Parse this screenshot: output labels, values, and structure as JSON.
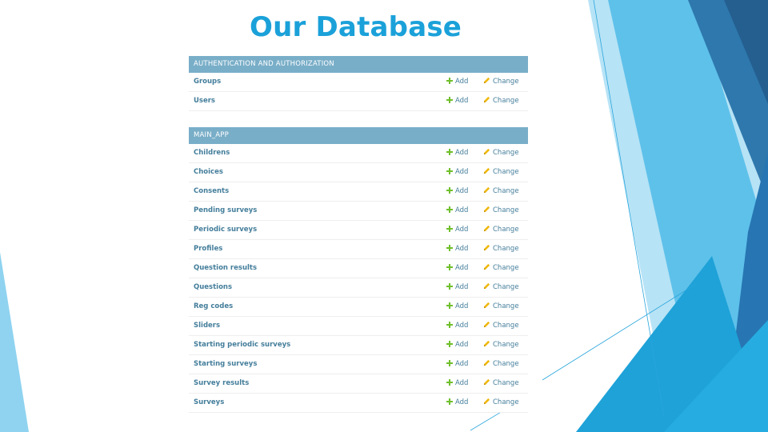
{
  "slide": {
    "title": "Our Database"
  },
  "colors": {
    "title": "#1ba1d9",
    "module_header_bg": "#79aec8",
    "link": "#447e9b",
    "add_icon": "#70bf2b",
    "change_icon": "#efb80b"
  },
  "admin": {
    "add_label": "Add",
    "change_label": "Change",
    "modules": [
      {
        "name": "AUTHENTICATION AND AUTHORIZATION",
        "models": [
          "Groups",
          "Users"
        ]
      },
      {
        "name": "MAIN_APP",
        "models": [
          "Childrens",
          "Choices",
          "Consents",
          "Pending surveys",
          "Periodic surveys",
          "Profiles",
          "Question results",
          "Questions",
          "Reg codes",
          "Sliders",
          "Starting periodic surveys",
          "Starting surveys",
          "Survey results",
          "Surveys"
        ]
      }
    ]
  }
}
